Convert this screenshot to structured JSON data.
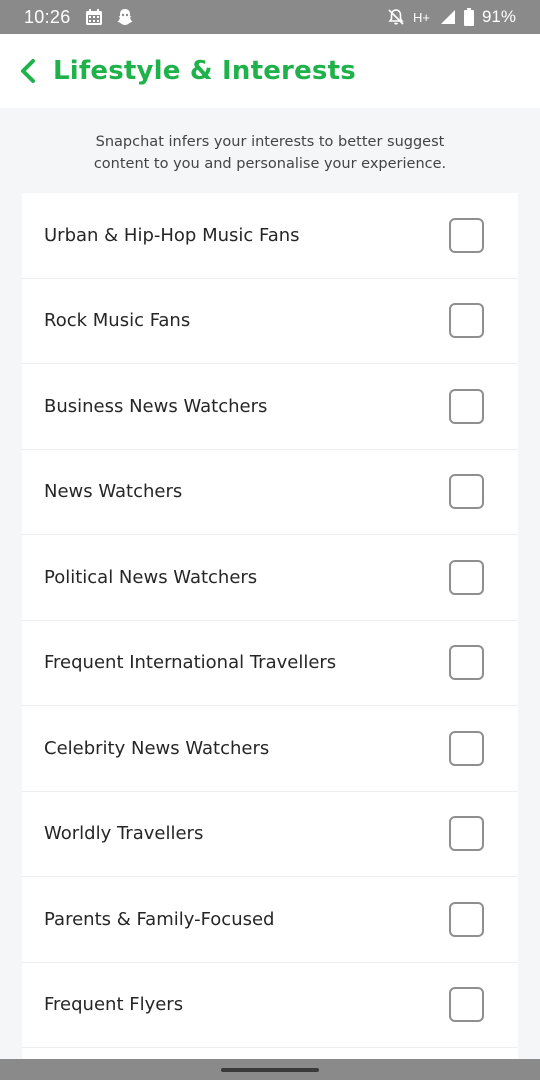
{
  "status_bar": {
    "time": "10:26",
    "network": "H+",
    "battery": "91%",
    "icons": [
      "calendar-icon",
      "snapchat-ghost-icon",
      "notifications-off-icon",
      "signal-icon",
      "battery-icon"
    ]
  },
  "header": {
    "title": "Lifestyle & Interests",
    "back_icon": "chevron-left-icon",
    "accent_color": "#1fb14a"
  },
  "description": {
    "line1": "Snapchat infers your interests to better suggest",
    "line2": "content to you and personalise your experience."
  },
  "interests": [
    {
      "label": "Urban & Hip-Hop Music Fans",
      "checked": false
    },
    {
      "label": "Rock Music Fans",
      "checked": false
    },
    {
      "label": "Business News Watchers",
      "checked": false
    },
    {
      "label": "News Watchers",
      "checked": false
    },
    {
      "label": "Political News Watchers",
      "checked": false
    },
    {
      "label": "Frequent International Travellers",
      "checked": false
    },
    {
      "label": "Celebrity News Watchers",
      "checked": false
    },
    {
      "label": "Worldly Travellers",
      "checked": false
    },
    {
      "label": "Parents & Family-Focused",
      "checked": false
    },
    {
      "label": "Frequent Flyers",
      "checked": false
    }
  ]
}
